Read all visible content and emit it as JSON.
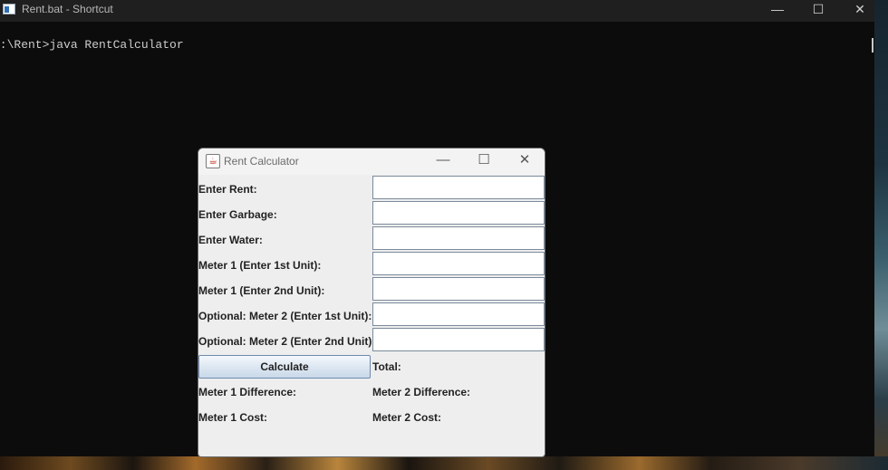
{
  "console": {
    "title": "Rent.bat - Shortcut",
    "minimize_glyph": "—",
    "maximize_glyph": "☐",
    "close_glyph": "✕",
    "command_line": "D:\\Rent>java RentCalculator"
  },
  "dialog": {
    "title": "Rent Calculator",
    "minimize_glyph": "—",
    "maximize_glyph": "☐",
    "close_glyph": "✕",
    "fields": [
      {
        "label": "Enter Rent:",
        "value": ""
      },
      {
        "label": "Enter Garbage:",
        "value": ""
      },
      {
        "label": "Enter Water:",
        "value": ""
      },
      {
        "label": "Meter 1 (Enter 1st Unit):",
        "value": ""
      },
      {
        "label": "Meter 1 (Enter 2nd Unit):",
        "value": ""
      },
      {
        "label": "Optional: Meter 2 (Enter 1st Unit):",
        "value": ""
      },
      {
        "label": "Optional: Meter 2 (Enter 2nd Unit):",
        "value": ""
      }
    ],
    "calculate_label": "Calculate",
    "total_label": "Total:",
    "meter1_difference_label": "Meter 1 Difference:",
    "meter2_difference_label": "Meter 2 Difference:",
    "meter1_cost_label": "Meter 1 Cost:",
    "meter2_cost_label": "Meter 2 Cost:"
  }
}
